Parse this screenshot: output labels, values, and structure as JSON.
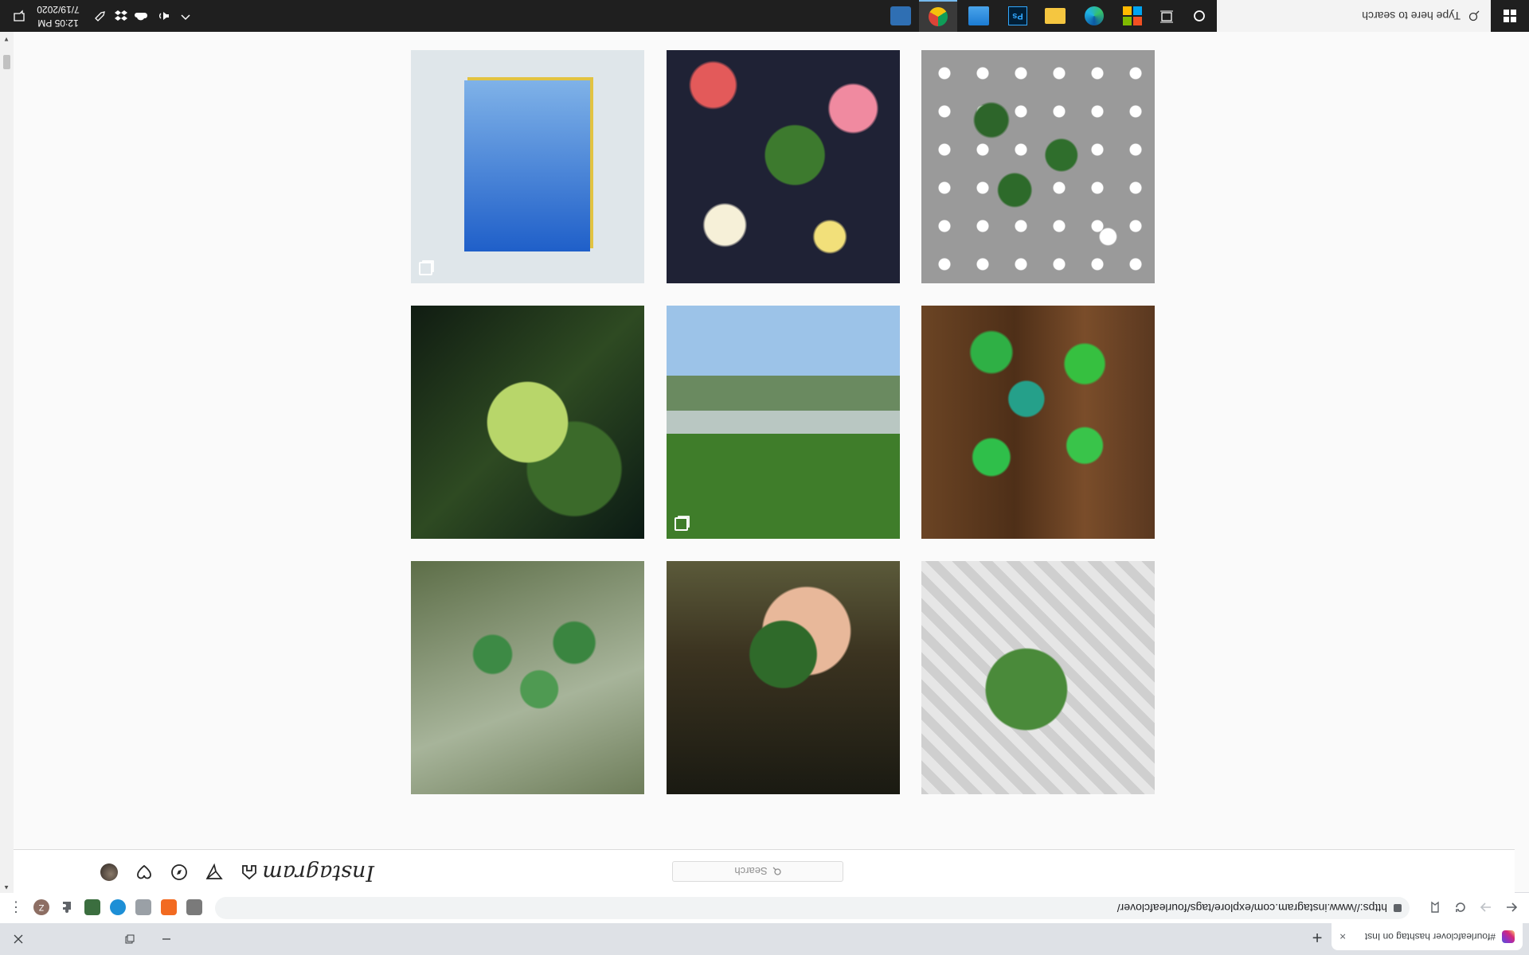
{
  "browser": {
    "tab_title": "#fourleafclover hashtag on Inst",
    "tab_close": "×",
    "new_tab": "+",
    "url": "https://www.instagram.com/explore/tags/fourleafclover/",
    "extensions": [
      "Z",
      "puzzle-icon",
      "pocket-icon",
      "ext-icon",
      "ext-icon",
      "ext-icon",
      "ext-icon"
    ],
    "profile_initial": "Z",
    "menu": "⋮"
  },
  "instagram": {
    "logo": "Instagram",
    "search_placeholder": "Search",
    "nav_icons": [
      "home-icon",
      "direct-icon",
      "explore-icon",
      "activity-icon",
      "profile-avatar"
    ]
  },
  "grid": {
    "photos": [
      {
        "id": "clover-hand-bricks",
        "multi": false
      },
      {
        "id": "clover-pond-hand",
        "multi": false
      },
      {
        "id": "clovers-grass",
        "multi": false
      },
      {
        "id": "clovers-wood",
        "multi": false
      },
      {
        "id": "woman-dog-grass",
        "multi": true
      },
      {
        "id": "clover-closeup-dark",
        "multi": false
      },
      {
        "id": "clovers-polka-dot",
        "multi": false
      },
      {
        "id": "clover-floral-fabric",
        "multi": false
      },
      {
        "id": "blue-card-clover",
        "multi": true
      },
      {
        "id": "partial-top-left",
        "multi": true
      },
      {
        "id": "partial-top-mid",
        "multi": false
      },
      {
        "id": "partial-top-right",
        "multi": true
      }
    ]
  },
  "taskbar": {
    "search_placeholder": "Type here to search",
    "time": "12:05 PM",
    "date": "7/19/2020"
  },
  "colors": {
    "taskbar_bg": "#1f1f1f",
    "chrome_bg": "#dee1e6",
    "ig_border": "#dbdbdb"
  }
}
